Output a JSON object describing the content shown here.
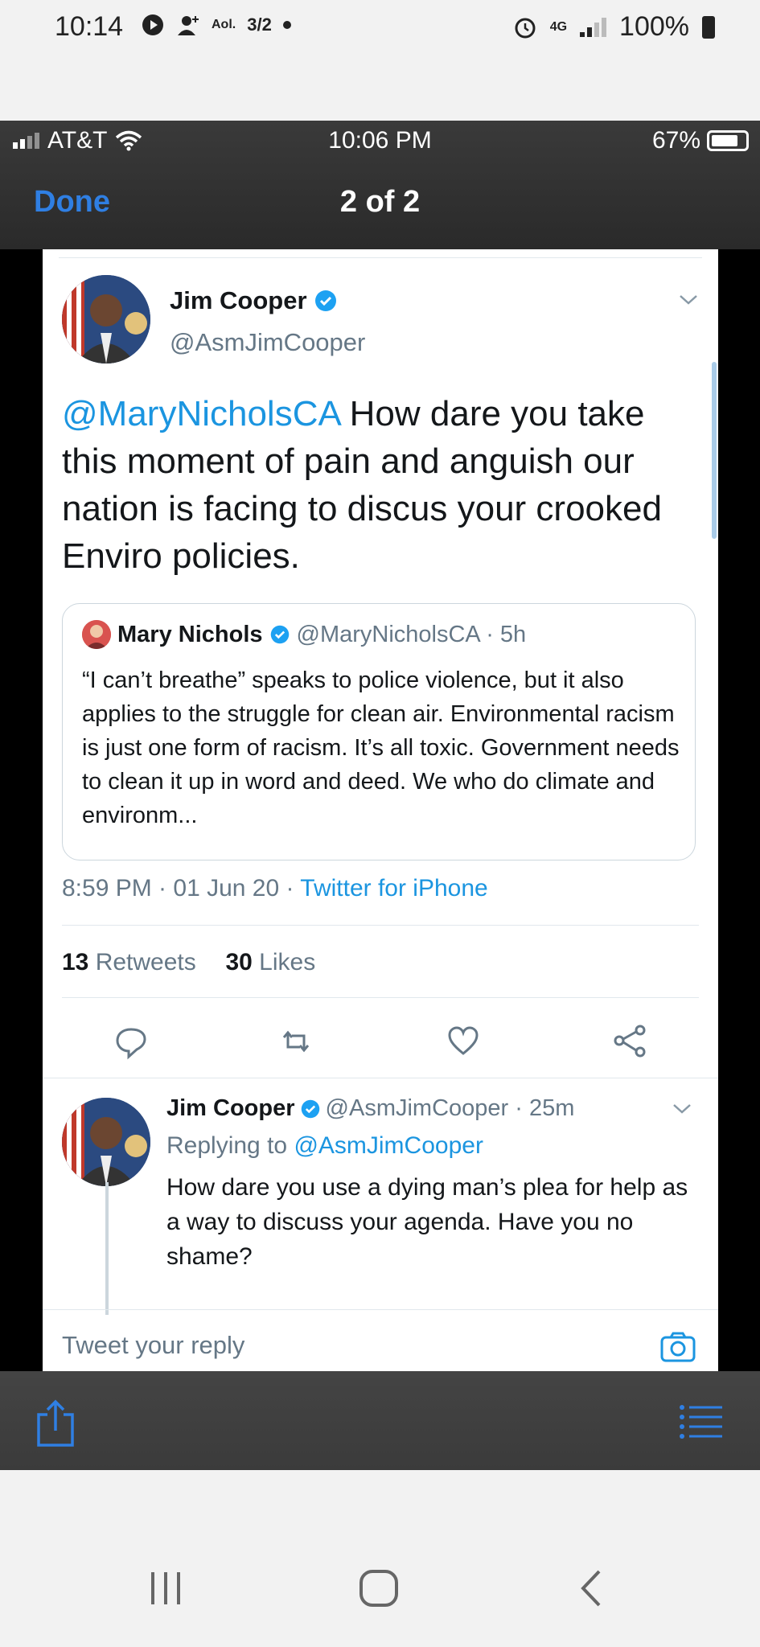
{
  "android_status": {
    "time": "10:14",
    "aol_label": "Aol.",
    "fraction": "3/2",
    "network": "4G",
    "battery": "100%"
  },
  "ios_status": {
    "carrier": "AT&T",
    "time": "10:06 PM",
    "battery": "67%"
  },
  "viewer": {
    "done_label": "Done",
    "pager": "2 of 2"
  },
  "tweet": {
    "author_name": "Jim Cooper",
    "author_handle": "@AsmJimCooper",
    "mention": "@MaryNicholsCA",
    "text": " How dare you take this moment of pain and anguish our nation is facing to discus your crooked Enviro policies.",
    "time": "8:59 PM · 01 Jun 20 · ",
    "source": "Twitter for iPhone",
    "retweets_count": "13",
    "retweets_label": " Retweets",
    "likes_count": "30",
    "likes_label": " Likes"
  },
  "quoted": {
    "name": "Mary Nichols",
    "handle": "@MaryNicholsCA · 5h",
    "text": "“I can’t breathe” speaks to police violence, but it also applies to the struggle for clean air. Environmental racism is just one form of racism. It’s all toxic. Government needs to clean it up in word and deed. We who do climate and environm..."
  },
  "reply": {
    "name": "Jim Cooper",
    "handle": "@AsmJimCooper · 25m",
    "replying_prefix": "Replying to ",
    "replying_handle": "@AsmJimCooper",
    "text": "How dare you use a dying man’s plea for help as a way to discuss your agenda. Have you no shame?"
  },
  "composer": {
    "placeholder": "Tweet your reply"
  },
  "colors": {
    "link_blue": "#1b95e0",
    "ios_blue": "#2f7fe3",
    "muted": "#657786"
  }
}
